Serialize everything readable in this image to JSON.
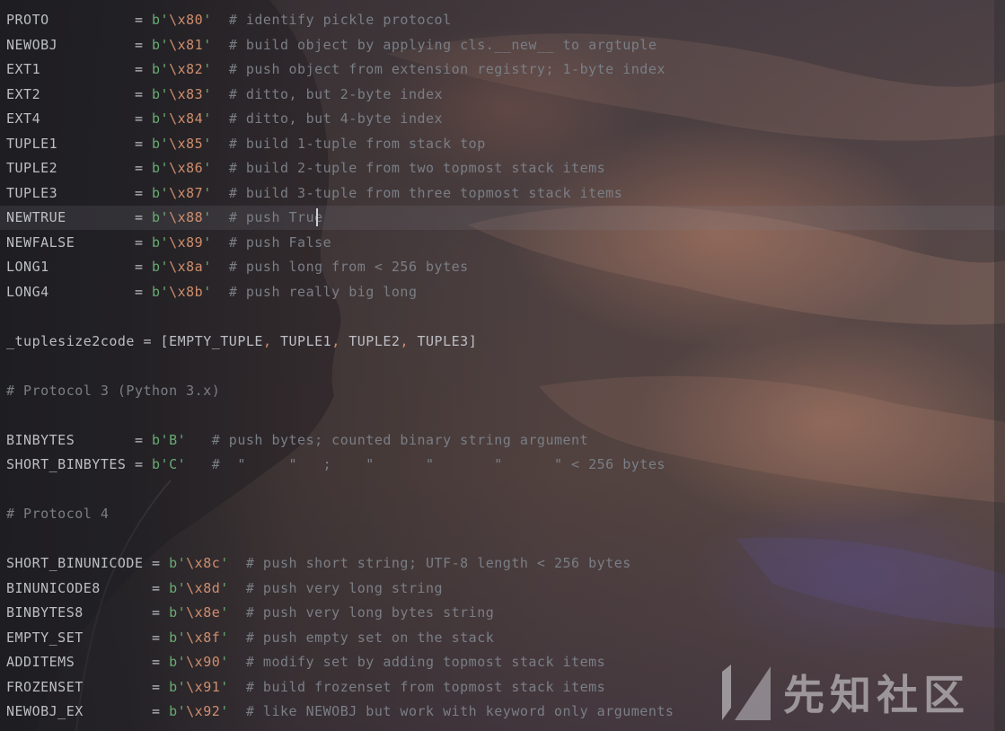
{
  "editor": {
    "lines": [
      {
        "type": "const",
        "name": "PROTO",
        "pad": "          ",
        "prefix": "b",
        "esc": "\\x80",
        "gap": "  ",
        "comment": "# identify pickle protocol"
      },
      {
        "type": "const",
        "name": "NEWOBJ",
        "pad": "         ",
        "prefix": "b",
        "esc": "\\x81",
        "gap": "  ",
        "comment": "# build object by applying cls.__new__ to argtuple"
      },
      {
        "type": "const",
        "name": "EXT1",
        "pad": "           ",
        "prefix": "b",
        "esc": "\\x82",
        "gap": "  ",
        "comment": "# push object from extension registry; 1-byte index"
      },
      {
        "type": "const",
        "name": "EXT2",
        "pad": "           ",
        "prefix": "b",
        "esc": "\\x83",
        "gap": "  ",
        "comment": "# ditto, but 2-byte index"
      },
      {
        "type": "const",
        "name": "EXT4",
        "pad": "           ",
        "prefix": "b",
        "esc": "\\x84",
        "gap": "  ",
        "comment": "# ditto, but 4-byte index"
      },
      {
        "type": "const",
        "name": "TUPLE1",
        "pad": "         ",
        "prefix": "b",
        "esc": "\\x85",
        "gap": "  ",
        "comment": "# build 1-tuple from stack top"
      },
      {
        "type": "const",
        "name": "TUPLE2",
        "pad": "         ",
        "prefix": "b",
        "esc": "\\x86",
        "gap": "  ",
        "comment": "# build 2-tuple from two topmost stack items"
      },
      {
        "type": "const",
        "name": "TUPLE3",
        "pad": "         ",
        "prefix": "b",
        "esc": "\\x87",
        "gap": "  ",
        "comment": "# build 3-tuple from three topmost stack items"
      },
      {
        "type": "const",
        "name": "NEWTRUE",
        "pad": "        ",
        "prefix": "b",
        "esc": "\\x88",
        "gap": "  ",
        "comment": "# push True"
      },
      {
        "type": "const",
        "name": "NEWFALSE",
        "pad": "       ",
        "prefix": "b",
        "esc": "\\x89",
        "gap": "  ",
        "comment": "# push False"
      },
      {
        "type": "const",
        "name": "LONG1",
        "pad": "          ",
        "prefix": "b",
        "esc": "\\x8a",
        "gap": "  ",
        "comment": "# push long from < 256 bytes"
      },
      {
        "type": "const",
        "name": "LONG4",
        "pad": "          ",
        "prefix": "b",
        "esc": "\\x8b",
        "gap": "  ",
        "comment": "# push really big long"
      },
      {
        "type": "blank"
      },
      {
        "type": "list",
        "name": "_tuplesize2code",
        "items": [
          "EMPTY_TUPLE",
          "TUPLE1",
          "TUPLE2",
          "TUPLE3"
        ]
      },
      {
        "type": "blank"
      },
      {
        "type": "comment",
        "text": "# Protocol 3 (Python 3.x)"
      },
      {
        "type": "blank"
      },
      {
        "type": "plain",
        "name": "BINBYTES",
        "pad": "       ",
        "value": "'B'",
        "gap": "   ",
        "comment": "# push bytes; counted binary string argument"
      },
      {
        "type": "plain",
        "name": "SHORT_BINBYTES",
        "pad": " ",
        "value": "'C'",
        "gap": "   ",
        "comment": "#  \"     \"   ;    \"      \"       \"      \" < 256 bytes"
      },
      {
        "type": "blank"
      },
      {
        "type": "comment",
        "text": "# Protocol 4"
      },
      {
        "type": "blank"
      },
      {
        "type": "const",
        "name": "SHORT_BINUNICODE",
        "pad": " ",
        "prefix": "b",
        "esc": "\\x8c",
        "gap": "  ",
        "comment": "# push short string; UTF-8 length < 256 bytes"
      },
      {
        "type": "const",
        "name": "BINUNICODE8",
        "pad": "      ",
        "prefix": "b",
        "esc": "\\x8d",
        "gap": "  ",
        "comment": "# push very long string"
      },
      {
        "type": "const",
        "name": "BINBYTES8",
        "pad": "        ",
        "prefix": "b",
        "esc": "\\x8e",
        "gap": "  ",
        "comment": "# push very long bytes string"
      },
      {
        "type": "const",
        "name": "EMPTY_SET",
        "pad": "        ",
        "prefix": "b",
        "esc": "\\x8f",
        "gap": "  ",
        "comment": "# push empty set on the stack"
      },
      {
        "type": "const",
        "name": "ADDITEMS",
        "pad": "         ",
        "prefix": "b",
        "esc": "\\x90",
        "gap": "  ",
        "comment": "# modify set by adding topmost stack items"
      },
      {
        "type": "const",
        "name": "FROZENSET",
        "pad": "        ",
        "prefix": "b",
        "esc": "\\x91",
        "gap": "  ",
        "comment": "# build frozenset from topmost stack items"
      },
      {
        "type": "const",
        "name": "NEWOBJ_EX",
        "pad": "        ",
        "prefix": "b",
        "esc": "\\x92",
        "gap": "  ",
        "comment": "# like NEWOBJ but work with keyword only arguments"
      }
    ],
    "current_line_index": 8
  },
  "watermark": {
    "text": "先知社区",
    "icon": "xianzhi-logo-icon"
  },
  "colors": {
    "identifier": "#bcbec4",
    "string": "#6aab73",
    "escape": "#cf8e6d",
    "comment": "#7a7e85"
  }
}
